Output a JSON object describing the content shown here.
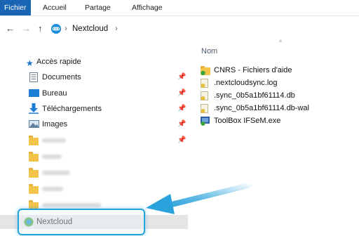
{
  "ribbon": {
    "tabs": [
      "Fichier",
      "Accueil",
      "Partage",
      "Affichage"
    ]
  },
  "address": {
    "back": "←",
    "forward": "→",
    "up": "↑",
    "separator": "›",
    "location": "Nextcloud"
  },
  "sidebar": {
    "quick_access": "Accès rapide",
    "items": [
      {
        "label": "Documents",
        "icon": "documents-icon",
        "pinned": true
      },
      {
        "label": "Bureau",
        "icon": "desktop-icon",
        "pinned": true
      },
      {
        "label": "Téléchargements",
        "icon": "downloads-icon",
        "pinned": true
      },
      {
        "label": "Images",
        "icon": "images-icon",
        "pinned": true
      }
    ],
    "nextcloud": "Nextcloud"
  },
  "content": {
    "column_name": "Nom",
    "files": [
      {
        "name": "CNRS - Fichiers d'aide",
        "icon": "synced-folder-icon"
      },
      {
        "name": ".nextcloudsync.log",
        "icon": "synced-file-icon"
      },
      {
        "name": ".sync_0b5a1bf61114.db",
        "icon": "synced-file-icon"
      },
      {
        "name": ".sync_0b5a1bf61114.db-wal",
        "icon": "synced-file-icon"
      },
      {
        "name": "ToolBox IFSeM.exe",
        "icon": "exe-icon"
      }
    ]
  },
  "colors": {
    "accent": "#1a64b4",
    "highlight": "#2aa2db",
    "sync_green": "#3aa63a",
    "folder": "#f2c54a"
  }
}
